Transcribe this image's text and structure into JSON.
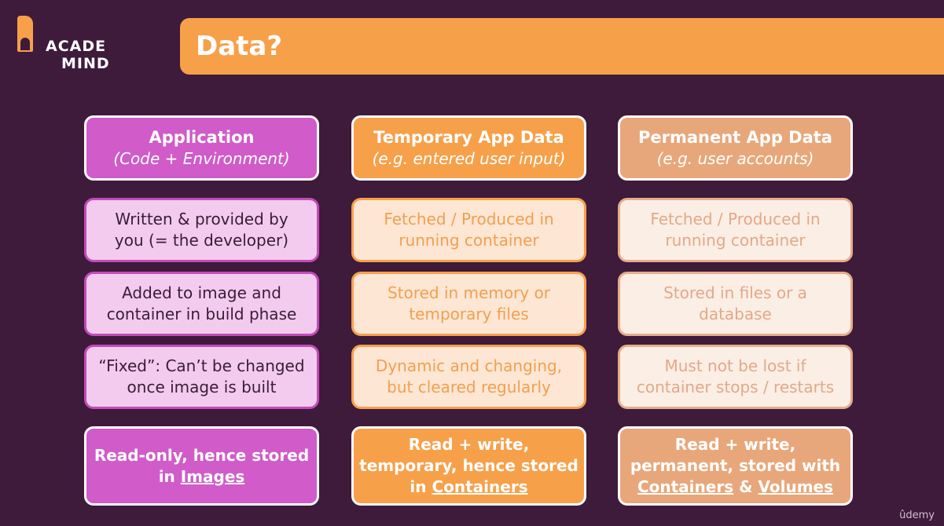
{
  "logo": {
    "line1": "ACADE",
    "line2": "MIND"
  },
  "title": "Data?",
  "columns": [
    {
      "heading": "Application",
      "subheading": "(Code + Environment)",
      "rows": [
        {
          "line1": "Written & provided by",
          "line2": "you (= the developer)"
        },
        {
          "line1": "Added to image and",
          "line2": "container in build phase"
        },
        {
          "line1": "“Fixed”: Can’t be changed",
          "line2": "once image is built"
        }
      ],
      "footer": {
        "line1": "Read-only, hence stored",
        "line2_prefix": "in ",
        "link1": "Images"
      }
    },
    {
      "heading": "Temporary App Data",
      "subheading": "(e.g. entered user input)",
      "rows": [
        {
          "line1": "Fetched / Produced in",
          "line2": "running container"
        },
        {
          "line1": "Stored in memory or",
          "line2": "temporary files"
        },
        {
          "line1": "Dynamic and changing,",
          "line2": "but cleared regularly"
        }
      ],
      "footer": {
        "line1": "Read + write,",
        "line2": "temporary, hence stored",
        "line3_prefix": "in ",
        "link1": "Containers"
      }
    },
    {
      "heading": "Permanent App Data",
      "subheading": "(e.g. user accounts)",
      "rows": [
        {
          "line1": "Fetched / Produced in",
          "line2": "running container"
        },
        {
          "line1": "Stored in files or a",
          "line2": "database"
        },
        {
          "line1": "Must not be lost if",
          "line2": "container stops / restarts"
        }
      ],
      "footer": {
        "line1": "Read + write,",
        "line2": "permanent, stored with",
        "link1": "Containers",
        "joiner": " & ",
        "link2": "Volumes"
      }
    }
  ],
  "watermark": "ûdemy"
}
